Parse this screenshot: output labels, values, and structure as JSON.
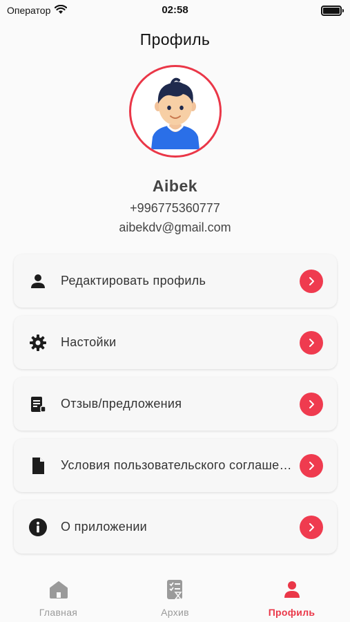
{
  "status_bar": {
    "carrier": "Оператор",
    "time": "02:58"
  },
  "header": {
    "title": "Профиль"
  },
  "profile": {
    "name": "Aibek",
    "phone": "+996775360777",
    "email": "aibekdv@gmail.com"
  },
  "menu": {
    "items": [
      {
        "label": "Редактировать профиль",
        "icon": "person-icon"
      },
      {
        "label": "Настойки",
        "icon": "gear-icon"
      },
      {
        "label": "Отзыв/предложения",
        "icon": "feedback-icon"
      },
      {
        "label": "Условия пользовательского соглашения",
        "icon": "document-icon"
      },
      {
        "label": "О приложении",
        "icon": "info-icon"
      }
    ]
  },
  "tabs": [
    {
      "label": "Главная",
      "icon": "home-icon",
      "active": false
    },
    {
      "label": "Архив",
      "icon": "archive-icon",
      "active": false
    },
    {
      "label": "Профиль",
      "icon": "profile-icon",
      "active": true
    }
  ],
  "colors": {
    "accent": "#ea3748",
    "inactive": "#9a9a9a",
    "background": "#fafafa"
  }
}
